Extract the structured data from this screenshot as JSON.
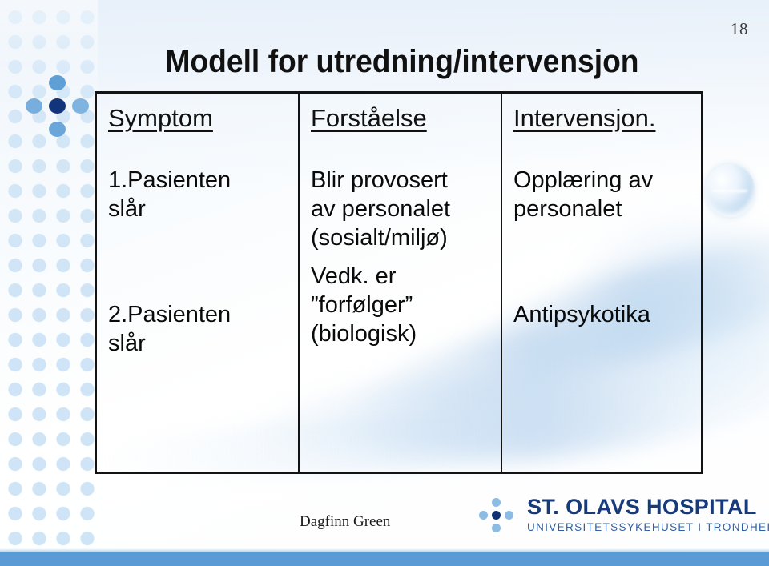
{
  "slide": {
    "number": "18",
    "title": "Modell for utredning/intervensjon",
    "author": "Dagfinn Green"
  },
  "table": {
    "columns": [
      {
        "header": "Symptom",
        "rows": [
          {
            "lines": [
              "1.Pasienten",
              "slår"
            ]
          },
          {
            "lines": [
              "2.Pasienten",
              "slår"
            ]
          }
        ]
      },
      {
        "header": "Forståelse",
        "rows": [
          {
            "lines": [
              "Blir provosert",
              "av personalet",
              "(sosialt/miljø)"
            ]
          },
          {
            "lines": [
              "Vedk. er",
              "”forfølger”",
              "(biologisk)"
            ]
          }
        ]
      },
      {
        "header": "Intervensjon.",
        "rows": [
          {
            "lines": [
              "Opplæring av",
              "personalet"
            ]
          },
          {
            "lines": [
              "Antipsykotika"
            ]
          }
        ]
      }
    ]
  },
  "logo": {
    "name": "ST. OLAVS HOSPITAL",
    "subtitle": "UNIVERSITETSSYKEHUSET I TRONDHEIM"
  },
  "colors": {
    "accent_dark_blue": "#12347a",
    "accent_blue": "#6fa8dc",
    "dot_pale": "#c4def4",
    "bottom_bar": "#5b9bd5",
    "logo_name": "#173a7a",
    "logo_subtitle": "#2f5fa4",
    "border": "#131313",
    "text": "#0a0a0a"
  }
}
